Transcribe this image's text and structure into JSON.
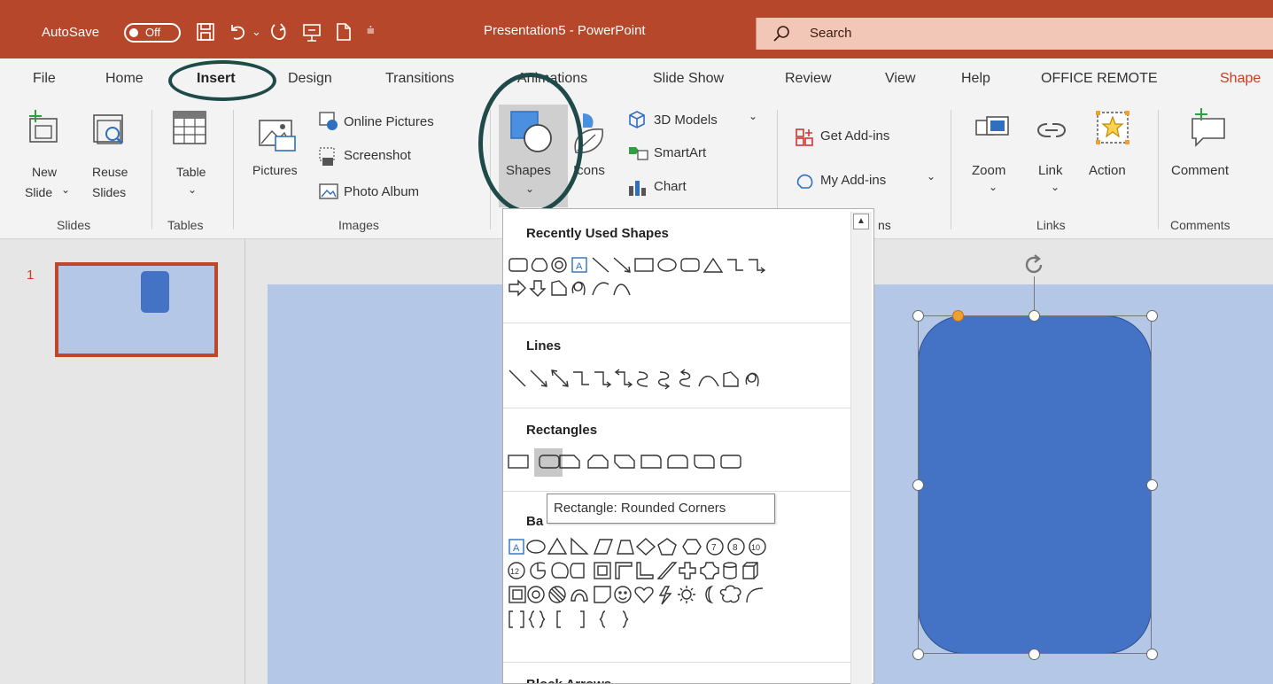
{
  "titlebar": {
    "autosave_label": "AutoSave",
    "autosave_state": "Off",
    "title": "Presentation5  -  PowerPoint",
    "search_placeholder": "Search",
    "bg_color": "#b7472a"
  },
  "tabs": [
    {
      "label": "File"
    },
    {
      "label": "Home"
    },
    {
      "label": "Insert",
      "active": true
    },
    {
      "label": "Design"
    },
    {
      "label": "Transitions"
    },
    {
      "label": "Animations"
    },
    {
      "label": "Slide Show"
    },
    {
      "label": "Review"
    },
    {
      "label": "View"
    },
    {
      "label": "Help"
    },
    {
      "label": "OFFICE REMOTE"
    },
    {
      "label": "Shape"
    }
  ],
  "ribbon": {
    "new_slide": {
      "line1": "New",
      "line2": "Slide",
      "chev": "⌄"
    },
    "reuse_slides": {
      "line1": "Reuse",
      "line2": "Slides"
    },
    "table": {
      "line1": "Table",
      "chev": "⌄"
    },
    "pictures": "Pictures",
    "online_pictures": "Online Pictures",
    "screenshot": "Screenshot",
    "photo_album": "Photo Album",
    "shapes": "Shapes",
    "icons": "Icons",
    "models_3d": "3D Models",
    "smartart": "SmartArt",
    "chart": "Chart",
    "get_addins": "Get Add-ins",
    "my_addins": "My Add-ins",
    "zoom": "Zoom",
    "link": "Link",
    "action": "Action",
    "comment": "Comment",
    "groups": {
      "slides": "Slides",
      "tables": "Tables",
      "images": "Images",
      "addins_partial": "ns",
      "links": "Links",
      "comments": "Comments"
    }
  },
  "slide_panel": {
    "slide_number": "1"
  },
  "shapes_gallery": {
    "sections": {
      "recent": "Recently Used Shapes",
      "lines": "Lines",
      "rectangles": "Rectangles",
      "basic_partial": "Ba",
      "block_arrows": "Block Arrows"
    },
    "tooltip": "Rectangle: Rounded Corners",
    "icon_names": [
      "rectangle-icon",
      "oval-icon",
      "rounded-rectangle-icon",
      "textbox-icon",
      "line-icon",
      "arrow-icon",
      "triangle-icon",
      "elbow-connector-icon",
      "curved-connector-icon",
      "block-arrow-right-icon",
      "block-arrow-down-icon",
      "freeform-icon",
      "scribble-icon",
      "arc-icon"
    ]
  },
  "colors": {
    "accent": "#c43e1c",
    "slide_bg": "#b4c7e7",
    "shape_fill": "#4472c4",
    "annotation_ring": "#1f4a4a"
  }
}
